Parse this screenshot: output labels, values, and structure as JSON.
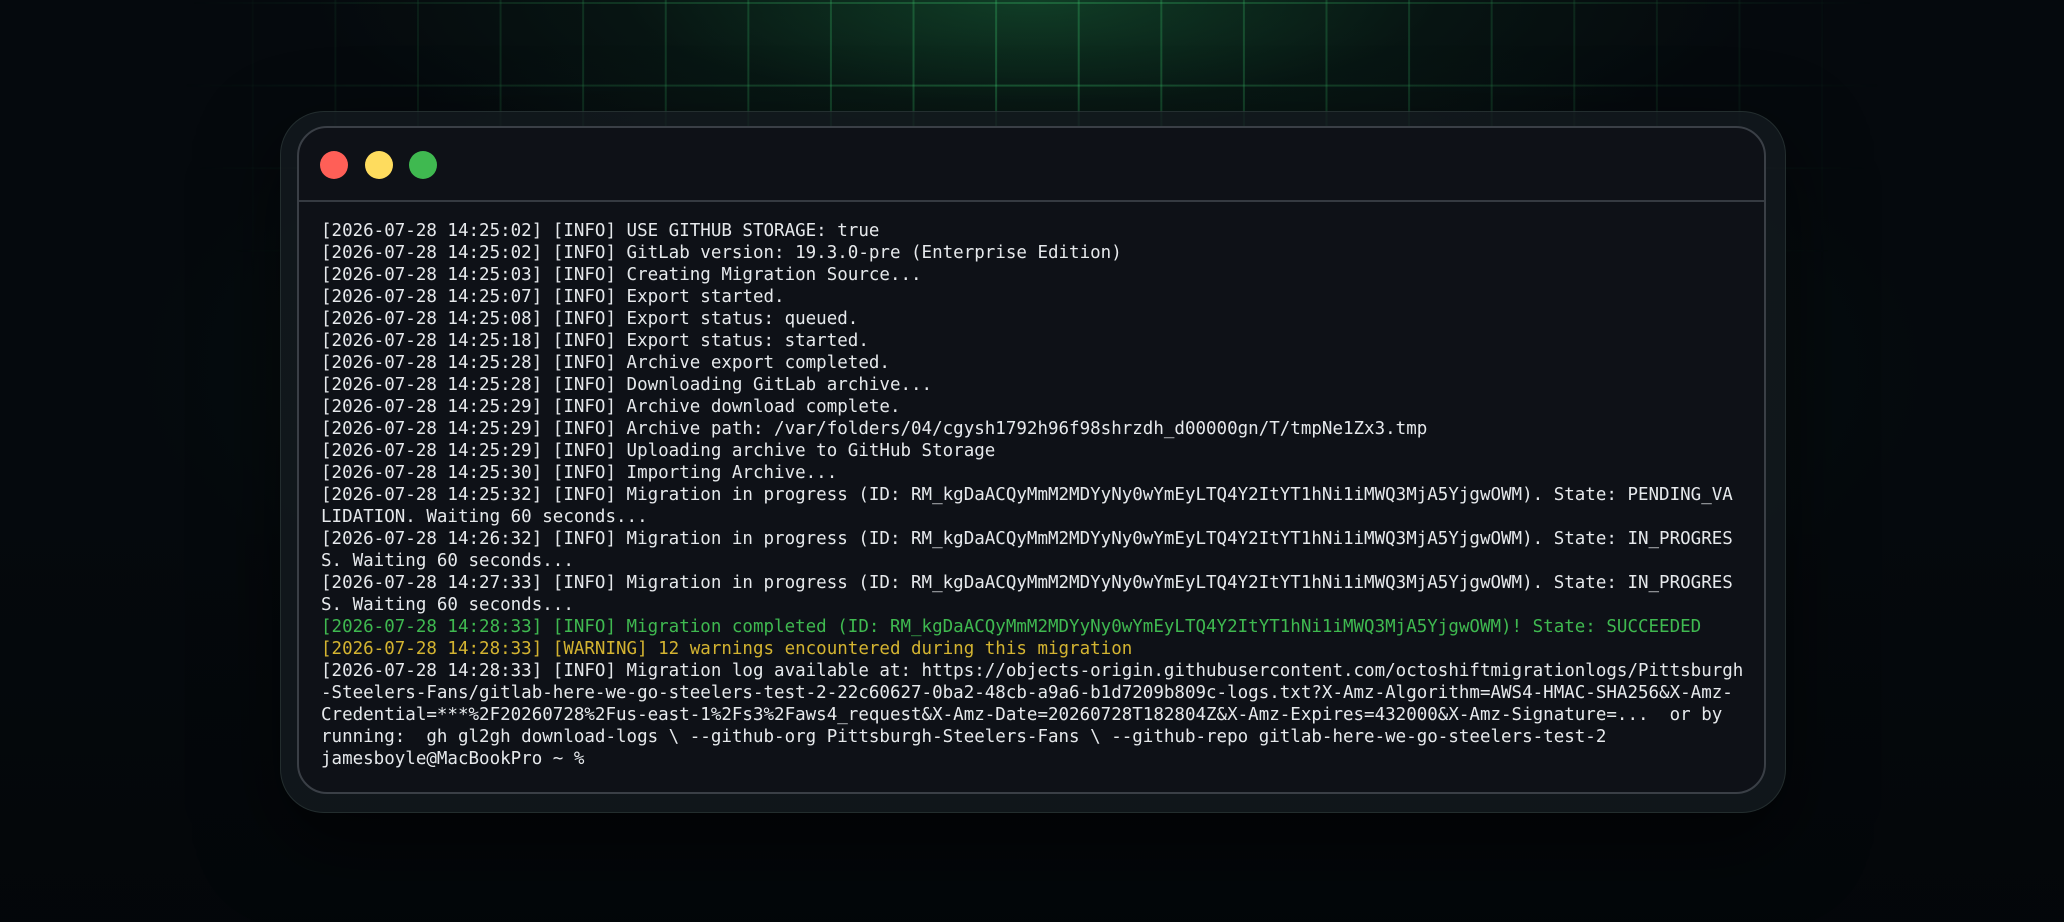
{
  "colors": {
    "close": "#ff5f57",
    "minimize": "#fedc5e",
    "maximize": "#3fb950",
    "text": "#e6e9ec",
    "success": "#3fb950",
    "warning": "#d4b431"
  },
  "window": {
    "controls": [
      "close-button",
      "minimize-button",
      "maximize-button"
    ]
  },
  "log": [
    {
      "text": "[2026-07-28 14:25:02] [INFO] USE GITHUB STORAGE: true",
      "type": "info"
    },
    {
      "text": "[2026-07-28 14:25:02] [INFO] GitLab version: 19.3.0-pre (Enterprise Edition)",
      "type": "info"
    },
    {
      "text": "[2026-07-28 14:25:03] [INFO] Creating Migration Source...",
      "type": "info"
    },
    {
      "text": "[2026-07-28 14:25:07] [INFO] Export started.",
      "type": "info"
    },
    {
      "text": "[2026-07-28 14:25:08] [INFO] Export status: queued.",
      "type": "info"
    },
    {
      "text": "[2026-07-28 14:25:18] [INFO] Export status: started.",
      "type": "info"
    },
    {
      "text": "[2026-07-28 14:25:28] [INFO] Archive export completed.",
      "type": "info"
    },
    {
      "text": "[2026-07-28 14:25:28] [INFO] Downloading GitLab archive...",
      "type": "info"
    },
    {
      "text": "[2026-07-28 14:25:29] [INFO] Archive download complete.",
      "type": "info"
    },
    {
      "text": "[2026-07-28 14:25:29] [INFO] Archive path: /var/folders/04/cgysh1792h96f98shrzdh_d00000gn/T/tmpNe1Zx3.tmp",
      "type": "info"
    },
    {
      "text": "[2026-07-28 14:25:29] [INFO] Uploading archive to GitHub Storage",
      "type": "info"
    },
    {
      "text": "[2026-07-28 14:25:30] [INFO] Importing Archive...",
      "type": "info"
    },
    {
      "text": "[2026-07-28 14:25:32] [INFO] Migration in progress (ID: RM_kgDaACQyMmM2MDYyNy0wYmEyLTQ4Y2ItYT1hNi1iMWQ3MjA5YjgwOWM). State: PENDING_VA",
      "type": "info"
    },
    {
      "text": "LIDATION. Waiting 60 seconds...",
      "type": "info"
    },
    {
      "text": "[2026-07-28 14:26:32] [INFO] Migration in progress (ID: RM_kgDaACQyMmM2MDYyNy0wYmEyLTQ4Y2ItYT1hNi1iMWQ3MjA5YjgwOWM). State: IN_PROGRES",
      "type": "info"
    },
    {
      "text": "S. Waiting 60 seconds...",
      "type": "info"
    },
    {
      "text": "[2026-07-28 14:27:33] [INFO] Migration in progress (ID: RM_kgDaACQyMmM2MDYyNy0wYmEyLTQ4Y2ItYT1hNi1iMWQ3MjA5YjgwOWM). State: IN_PROGRES",
      "type": "info"
    },
    {
      "text": "S. Waiting 60 seconds...",
      "type": "info"
    },
    {
      "text": "[2026-07-28 14:28:33] [INFO] Migration completed (ID: RM_kgDaACQyMmM2MDYyNy0wYmEyLTQ4Y2ItYT1hNi1iMWQ3MjA5YjgwOWM)! State: SUCCEEDED",
      "type": "success"
    },
    {
      "text": "[2026-07-28 14:28:33] [WARNING] 12 warnings encountered during this migration",
      "type": "warning"
    },
    {
      "text": "[2026-07-28 14:28:33] [INFO] Migration log available at: https://objects-origin.githubusercontent.com/octoshiftmigrationlogs/Pittsburgh",
      "type": "info"
    },
    {
      "text": "-Steelers-Fans/gitlab-here-we-go-steelers-test-2-22c60627-0ba2-48cb-a9a6-b1d7209b809c-logs.txt?X-Amz-Algorithm=AWS4-HMAC-SHA256&X-Amz-",
      "type": "info"
    },
    {
      "text": "Credential=***%2F20260728%2Fus-east-1%2Fs3%2Faws4_request&X-Amz-Date=20260728T182804Z&X-Amz-Expires=432000&X-Amz-Signature=...  or by",
      "type": "info"
    },
    {
      "text": "running:  gh gl2gh download-logs \\ --github-org Pittsburgh-Steelers-Fans \\ --github-repo gitlab-here-we-go-steelers-test-2",
      "type": "info"
    },
    {
      "text": "jamesboyle@MacBookPro ~ %",
      "type": "prompt"
    }
  ]
}
